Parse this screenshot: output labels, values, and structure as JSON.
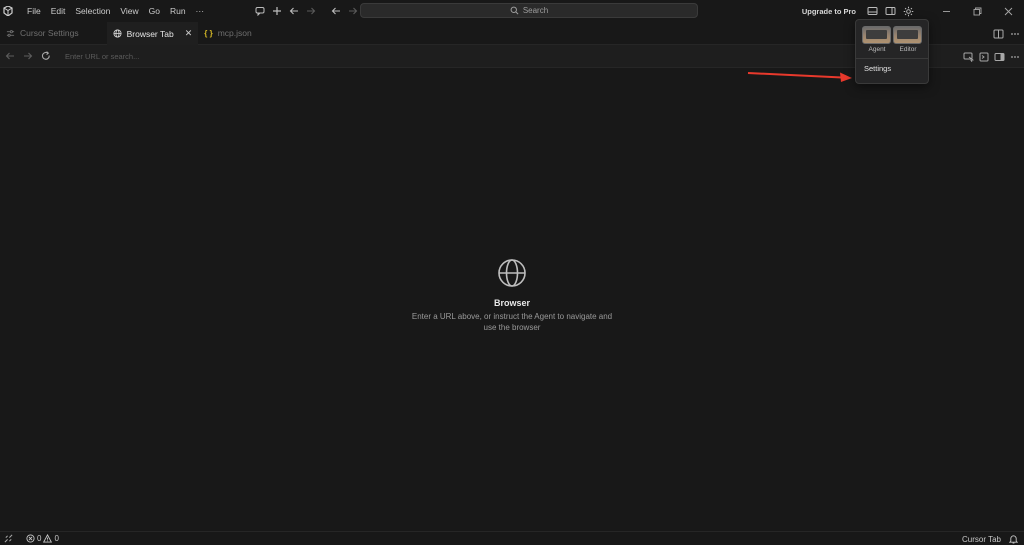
{
  "titlebar": {
    "menu": [
      "File",
      "Edit",
      "Selection",
      "View",
      "Go",
      "Run",
      "···"
    ],
    "search_placeholder": "Search",
    "upgrade_label": "Upgrade to Pro"
  },
  "tabs": [
    {
      "label": "Cursor Settings",
      "icon": "settings-sliders-icon",
      "active": false
    },
    {
      "label": "Browser Tab",
      "icon": "globe-icon",
      "active": true,
      "close": "✕"
    },
    {
      "label": "mcp.json",
      "icon": "json-braces-icon",
      "icon_text": "{ }",
      "active": false
    }
  ],
  "navbar": {
    "url_placeholder": "Enter URL or search..."
  },
  "empty_state": {
    "title": "Browser",
    "description": "Enter a URL above, or instruct the Agent to navigate and use the browser"
  },
  "popover": {
    "layouts": [
      {
        "label": "Agent"
      },
      {
        "label": "Editor"
      }
    ],
    "settings_label": "Settings"
  },
  "statusbar": {
    "errors": "0",
    "warnings": "0",
    "cursor_tab": "Cursor Tab"
  },
  "colors": {
    "background": "#181818",
    "annotation_arrow": "#e8392c",
    "json_icon": "#d7ba26"
  }
}
